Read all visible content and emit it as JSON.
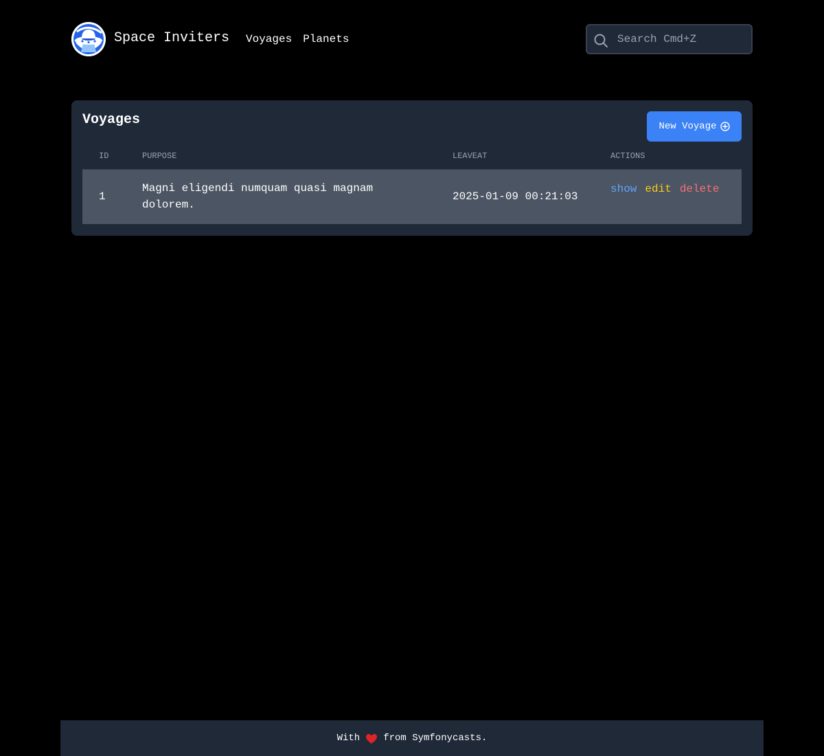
{
  "header": {
    "brand": "Space Inviters",
    "logo_icon": "ufo-icon",
    "nav": [
      {
        "label": "Voyages"
      },
      {
        "label": "Planets"
      }
    ],
    "search": {
      "placeholder": "Search Cmd+Z",
      "value": "",
      "icon": "search-icon"
    }
  },
  "main": {
    "title": "Voyages",
    "new_button": {
      "label": "New Voyage",
      "icon": "plus-circle-icon"
    },
    "table": {
      "columns": [
        "Id",
        "Purpose",
        "LeaveAt",
        "Actions"
      ],
      "rows": [
        {
          "id": "1",
          "purpose": "Magni eligendi numquam quasi magnam dolorem.",
          "leave_at": "2025-01-09 00:21:03",
          "actions": {
            "show": "show",
            "edit": "edit",
            "delete": "delete"
          }
        }
      ]
    }
  },
  "footer": {
    "prefix": "With",
    "icon": "heart-icon",
    "suffix": "from Symfonycasts."
  },
  "colors": {
    "background": "#000000",
    "panel": "#1f2937",
    "row": "#4b5563",
    "accent": "#3b82f6",
    "show": "#60a5fa",
    "edit": "#facc15",
    "delete": "#f87171",
    "heart": "#dc2626"
  }
}
